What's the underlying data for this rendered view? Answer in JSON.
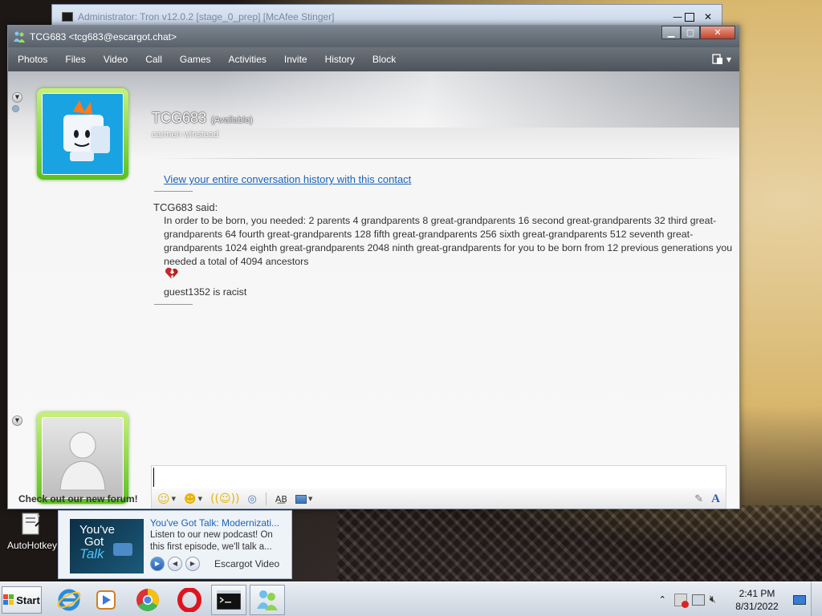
{
  "background_window": {
    "title": "Administrator:  Tron v12.0.2 [stage_0_prep] [McAfee Stinger]"
  },
  "window": {
    "title": "TCG683 <tcg683@escargot.chat>",
    "menu": [
      "Photos",
      "Files",
      "Video",
      "Call",
      "Games",
      "Activities",
      "Invite",
      "History",
      "Block"
    ]
  },
  "contact": {
    "name": "TCG683",
    "status": "(Available)",
    "personal_message": "carmen winstead"
  },
  "conversation": {
    "history_link": "View your entire conversation history with this contact",
    "sender_line": "TCG683 said:",
    "message": "In order to be born, you needed: 2 parents 4 grandparents 8 great-grandparents 16 second great-grandparents 32 third great-grandparents 64 fourth great-grandparents 128 fifth great-grandparents 256 sixth great-grandparents 512 seventh great-grandparents 1024 eighth great-grandparents 2048 ninth great-grandparents for you to be born from 12 previous generations you needed a total of 4094 ancestors",
    "message2": "guest1352 is racist"
  },
  "input": {
    "value": "",
    "placeholder": ""
  },
  "forum_link": "Check out our new forum!",
  "desktop_icon": {
    "label": "AutoHotkey"
  },
  "ad": {
    "image_text_1": "You've",
    "image_text_2": "Got",
    "image_text_3": "Talk",
    "title": "You've Got Talk: Modernizati...",
    "body": "Listen to our new podcast! On this first episode, we'll talk a...",
    "source": "Escargot Video"
  },
  "taskbar": {
    "start_label": "Start",
    "time": "2:41 PM",
    "date": "8/31/2022"
  },
  "colors": {
    "avatar_frame": "#5bc01e",
    "link": "#1a62b8",
    "titlebar": "#58606a"
  }
}
